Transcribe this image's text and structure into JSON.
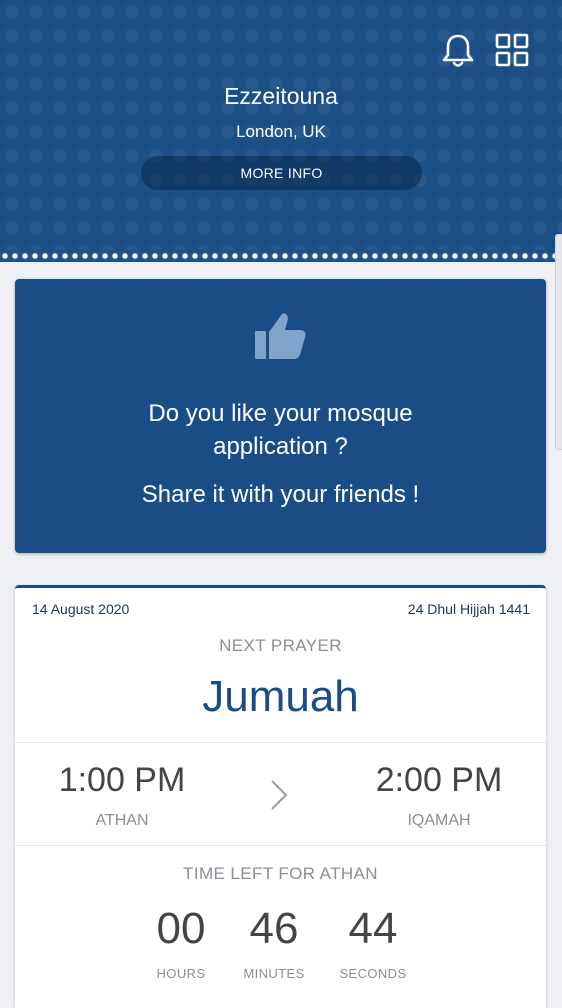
{
  "header": {
    "mosque_name": "Ezzeitouna",
    "location": "London, UK",
    "more_info_label": "MORE INFO",
    "icons": [
      "bell-icon",
      "grid-icon"
    ],
    "background_color": "#1c4f86"
  },
  "share_card": {
    "icon": "thumbs-up-icon",
    "line1": "Do you like your mosque",
    "line1b": "application ?",
    "line2": "Share it with your friends !",
    "background_color": "#1a4d85"
  },
  "prayer": {
    "date_gregorian": "14 August 2020",
    "date_hijri": "24 Dhul Hijjah 1441",
    "next_label": "NEXT PRAYER",
    "next_name": "Jumuah",
    "athan_time": "1:00 PM",
    "athan_label": "ATHAN",
    "iqamah_time": "2:00 PM",
    "iqamah_label": "IQAMAH",
    "time_left_label": "TIME LEFT FOR ATHAN",
    "countdown": {
      "hours": "00",
      "hours_label": "HOURS",
      "minutes": "46",
      "minutes_label": "MINUTES",
      "seconds": "44",
      "seconds_label": "SECONDS"
    },
    "accent_color": "#1a4d85"
  }
}
